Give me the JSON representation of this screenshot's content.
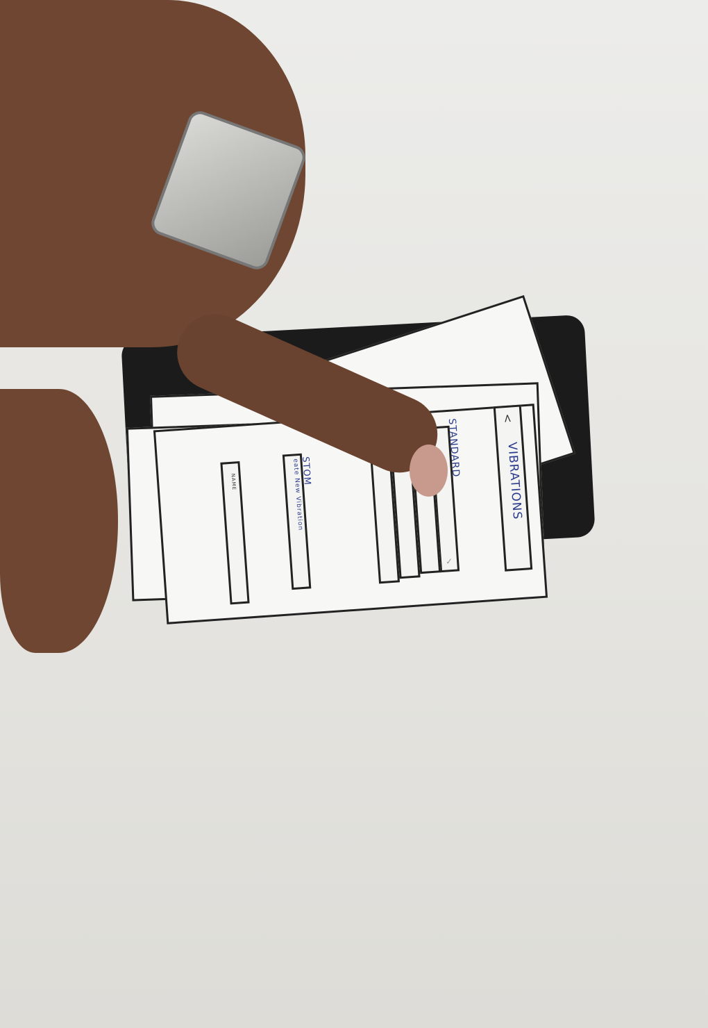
{
  "prototype": {
    "title": "VIBRATIONS",
    "back_icon": "chevron-left-icon",
    "section_standard": "STANDARD",
    "section_custom": "STOM",
    "create_link": "eate New Vibration",
    "name_field": "NAME",
    "check_icon": "checkmark-icon"
  },
  "colors": {
    "ink": "#2c3d8f",
    "paper": "#f7f7f5",
    "background": "#e6e5e1",
    "skin": "#6e4632"
  }
}
